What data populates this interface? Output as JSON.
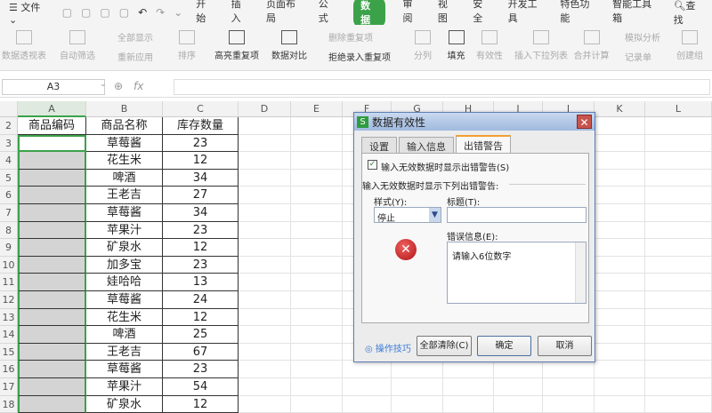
{
  "menubar": {
    "file": "文件",
    "tabs": [
      "开始",
      "插入",
      "页面布局",
      "公式",
      "数据",
      "审阅",
      "视图",
      "安全",
      "开发工具",
      "特色功能",
      "智能工具箱"
    ],
    "active_tab": "数据",
    "search": "查找"
  },
  "ribbon": {
    "items": [
      "数据透视表",
      "自动筛选",
      "全部显示",
      "重新应用",
      "排序",
      "高亮重复项",
      "数据对比",
      "删除重复项",
      "拒绝录入重复项",
      "分列",
      "填充",
      "有效性",
      "插入下拉列表",
      "合并计算",
      "模拟分析",
      "记录单",
      "创建组"
    ]
  },
  "formula_bar": {
    "name_box": "A3",
    "fx": "fx",
    "value": ""
  },
  "columns": [
    "A",
    "B",
    "C",
    "D",
    "E",
    "F",
    "G",
    "H",
    "I",
    "J",
    "K",
    "L"
  ],
  "headers": [
    "商品编码",
    "商品名称",
    "库存数量"
  ],
  "rows": [
    {
      "n": "3",
      "name": "草莓酱",
      "qty": "23"
    },
    {
      "n": "4",
      "name": "花生米",
      "qty": "12"
    },
    {
      "n": "5",
      "name": "啤酒",
      "qty": "34"
    },
    {
      "n": "6",
      "name": "王老吉",
      "qty": "27"
    },
    {
      "n": "7",
      "name": "草莓酱",
      "qty": "34"
    },
    {
      "n": "8",
      "name": "苹果汁",
      "qty": "23"
    },
    {
      "n": "9",
      "name": "矿泉水",
      "qty": "12"
    },
    {
      "n": "10",
      "name": "加多宝",
      "qty": "23"
    },
    {
      "n": "11",
      "name": "娃哈哈",
      "qty": "13"
    },
    {
      "n": "12",
      "name": "草莓酱",
      "qty": "24"
    },
    {
      "n": "13",
      "name": "花生米",
      "qty": "12"
    },
    {
      "n": "14",
      "name": "啤酒",
      "qty": "25"
    },
    {
      "n": "15",
      "name": "王老吉",
      "qty": "67"
    },
    {
      "n": "16",
      "name": "草莓酱",
      "qty": "23"
    },
    {
      "n": "17",
      "name": "苹果汁",
      "qty": "54"
    },
    {
      "n": "18",
      "name": "矿泉水",
      "qty": "12"
    }
  ],
  "dialog": {
    "title": "数据有效性",
    "tabs": [
      "设置",
      "输入信息",
      "出错警告"
    ],
    "checkbox": "输入无效数据时显示出错警告(S)",
    "section": "输入无效数据时显示下列出错警告:",
    "style_label": "样式(Y):",
    "style_value": "停止",
    "title_label": "标题(T):",
    "title_value": "",
    "error_label": "错误信息(E):",
    "error_value": "请输入6位数字",
    "tips": "操作技巧",
    "clear": "全部清除(C)",
    "ok": "确定",
    "cancel": "取消"
  }
}
